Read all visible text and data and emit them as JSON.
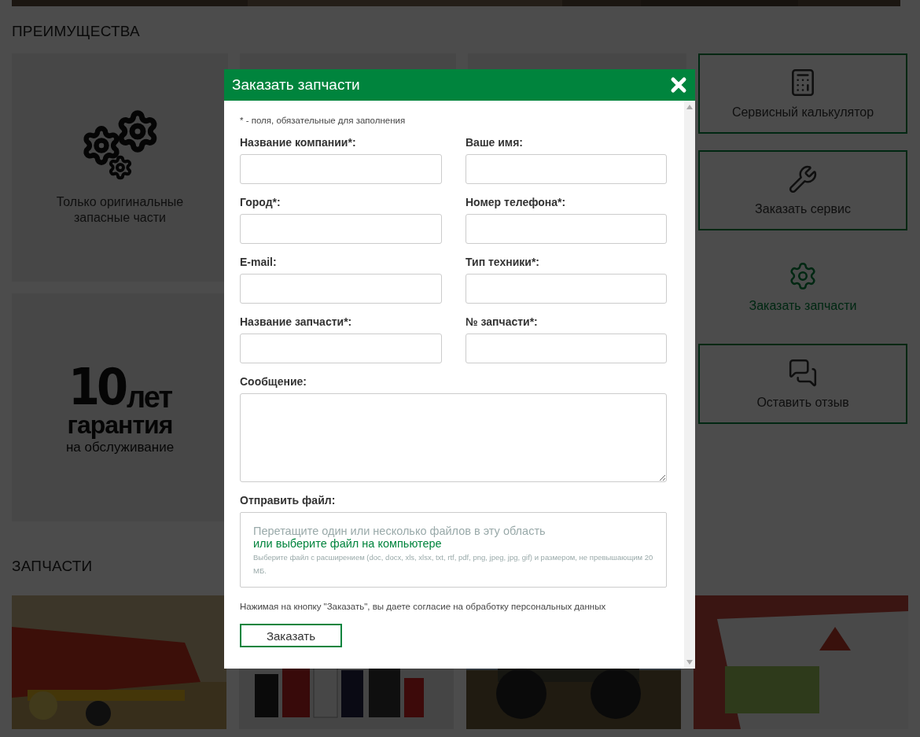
{
  "advantages": {
    "heading": "ПРЕИМУЩЕСТВА",
    "cards": [
      {
        "kind": "gears",
        "text": "Только оригинальные запасные части"
      },
      {
        "kind": "blank"
      },
      {
        "kind": "blank"
      },
      {
        "kind": "warranty",
        "number": "10",
        "unit": "лет",
        "word": "гарантия",
        "caption": "на обслуживание"
      }
    ]
  },
  "actions": [
    {
      "label": "Сервисный калькулятор",
      "selected": false
    },
    {
      "label": "Заказать сервис",
      "selected": false
    },
    {
      "label": "Заказать запчасти",
      "selected": true
    },
    {
      "label": "Оставить отзыв",
      "selected": false
    }
  ],
  "parts": {
    "heading": "ЗАПЧАСТИ"
  },
  "modal": {
    "title": "Заказать запчасти",
    "note": "* - поля, обязательные для заполнения",
    "fields": [
      {
        "kind": "input",
        "label": "Название компании*:"
      },
      {
        "kind": "input",
        "label": "Ваше имя:"
      },
      {
        "kind": "input",
        "label": "Город*:"
      },
      {
        "kind": "input",
        "label": "Номер телефона*:"
      },
      {
        "kind": "input",
        "label": "E-mail:"
      },
      {
        "kind": "input",
        "label": "Тип техники*:"
      },
      {
        "kind": "input",
        "label": "Название запчасти*:"
      },
      {
        "kind": "input",
        "label": "№ запчасти*:"
      },
      {
        "kind": "textarea",
        "label": "Сообщение:"
      }
    ],
    "file": {
      "label": "Отправить файл:",
      "drop_text": "Перетащите один или несколько файлов в эту область",
      "link": "или выберите файл на компьютере",
      "hint": "Выберите файл с расширением (doc, docx, xls, xlsx, txt, rtf, pdf, png, jpeg, jpg, gif) и размером, не превышающим 20 МБ."
    },
    "consent": "Нажимая на кнопку \"Заказать\", вы даете согласие на обработку персональных данных",
    "submit": "Заказать"
  }
}
